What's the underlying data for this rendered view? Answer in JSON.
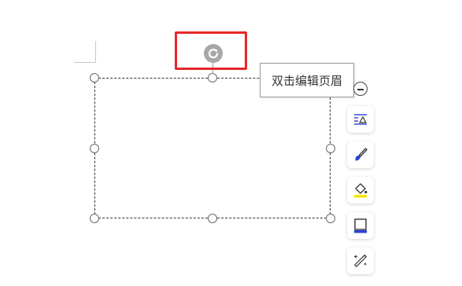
{
  "tooltip": {
    "text": "双击编辑页眉"
  },
  "highlight": {
    "color": "#e8262a"
  },
  "toolbar": {
    "items": [
      {
        "icon": "text-wrap-icon"
      },
      {
        "icon": "brush-icon"
      },
      {
        "icon": "fill-bucket-icon"
      },
      {
        "icon": "outline-icon"
      },
      {
        "icon": "magic-wand-icon"
      }
    ]
  },
  "colors": {
    "accent_blue": "#2a3fd6",
    "accent_yellow": "#f2e600",
    "handle_border": "#6a6a6a",
    "rotate_handle": "#a8a8a8"
  }
}
